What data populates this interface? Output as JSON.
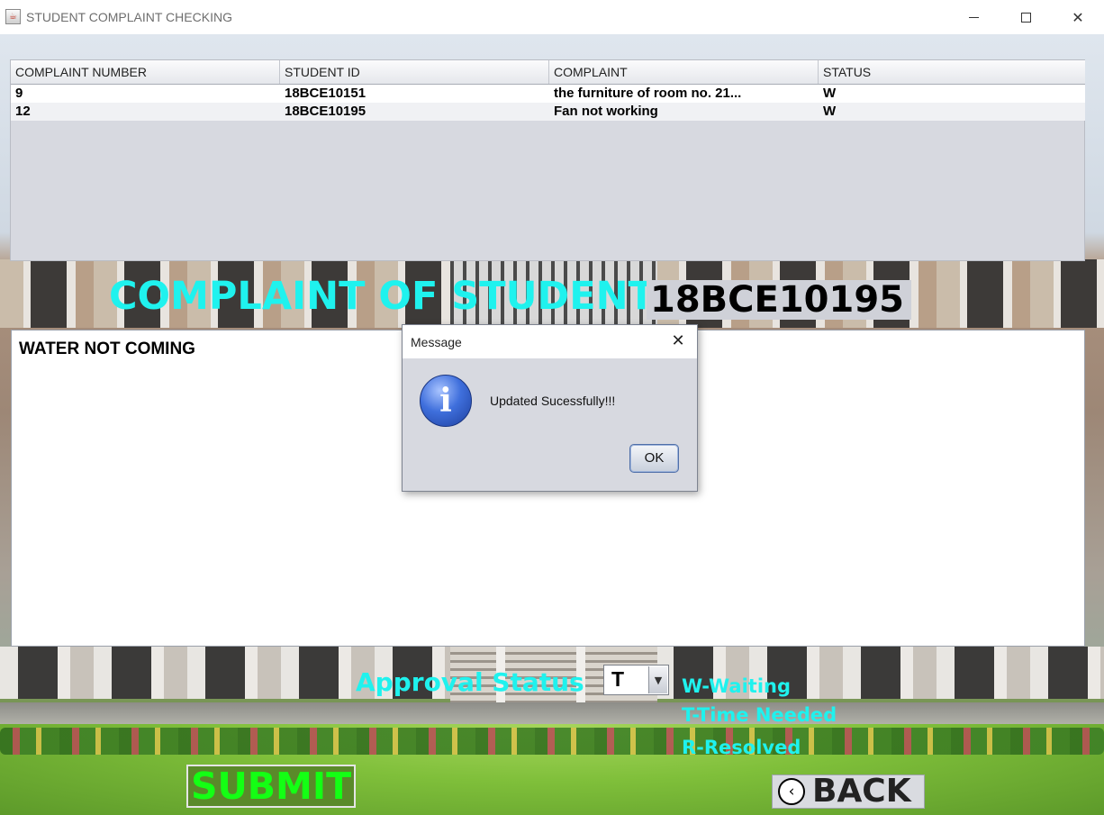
{
  "window": {
    "title": "STUDENT COMPLAINT CHECKING",
    "app_icon": "java-cup-icon",
    "controls": {
      "minimize": "minimize-icon",
      "maximize": "maximize-icon",
      "close": "close-icon"
    }
  },
  "table": {
    "columns": [
      "COMPLAINT NUMBER",
      "STUDENT ID",
      "COMPLAINT",
      "STATUS"
    ],
    "rows": [
      [
        "9",
        "18BCE10151",
        "the furniture of room no. 21...",
        "W"
      ],
      [
        "12",
        "18BCE10195",
        "Fan not working",
        "W"
      ]
    ]
  },
  "heading": {
    "label": "COMPLAINT OF STUDENT",
    "student_id": "18BCE10195"
  },
  "complaint": {
    "text": "WATER NOT COMING"
  },
  "approval": {
    "label": "Approval Status",
    "selected": "T",
    "legend": [
      "W-Waiting",
      "T-Time Needed",
      "R-Resolved"
    ]
  },
  "buttons": {
    "submit": "SUBMIT",
    "back": "BACK",
    "back_icon": "chevron-left-icon"
  },
  "dialog": {
    "title": "Message",
    "message": "Updated Sucessfully!!!",
    "ok": "OK",
    "icon": "info-icon"
  },
  "colors": {
    "accent_cyan": "#1ff2ee",
    "submit_green": "#14ff14",
    "panel_gray": "#d7d9e0"
  }
}
